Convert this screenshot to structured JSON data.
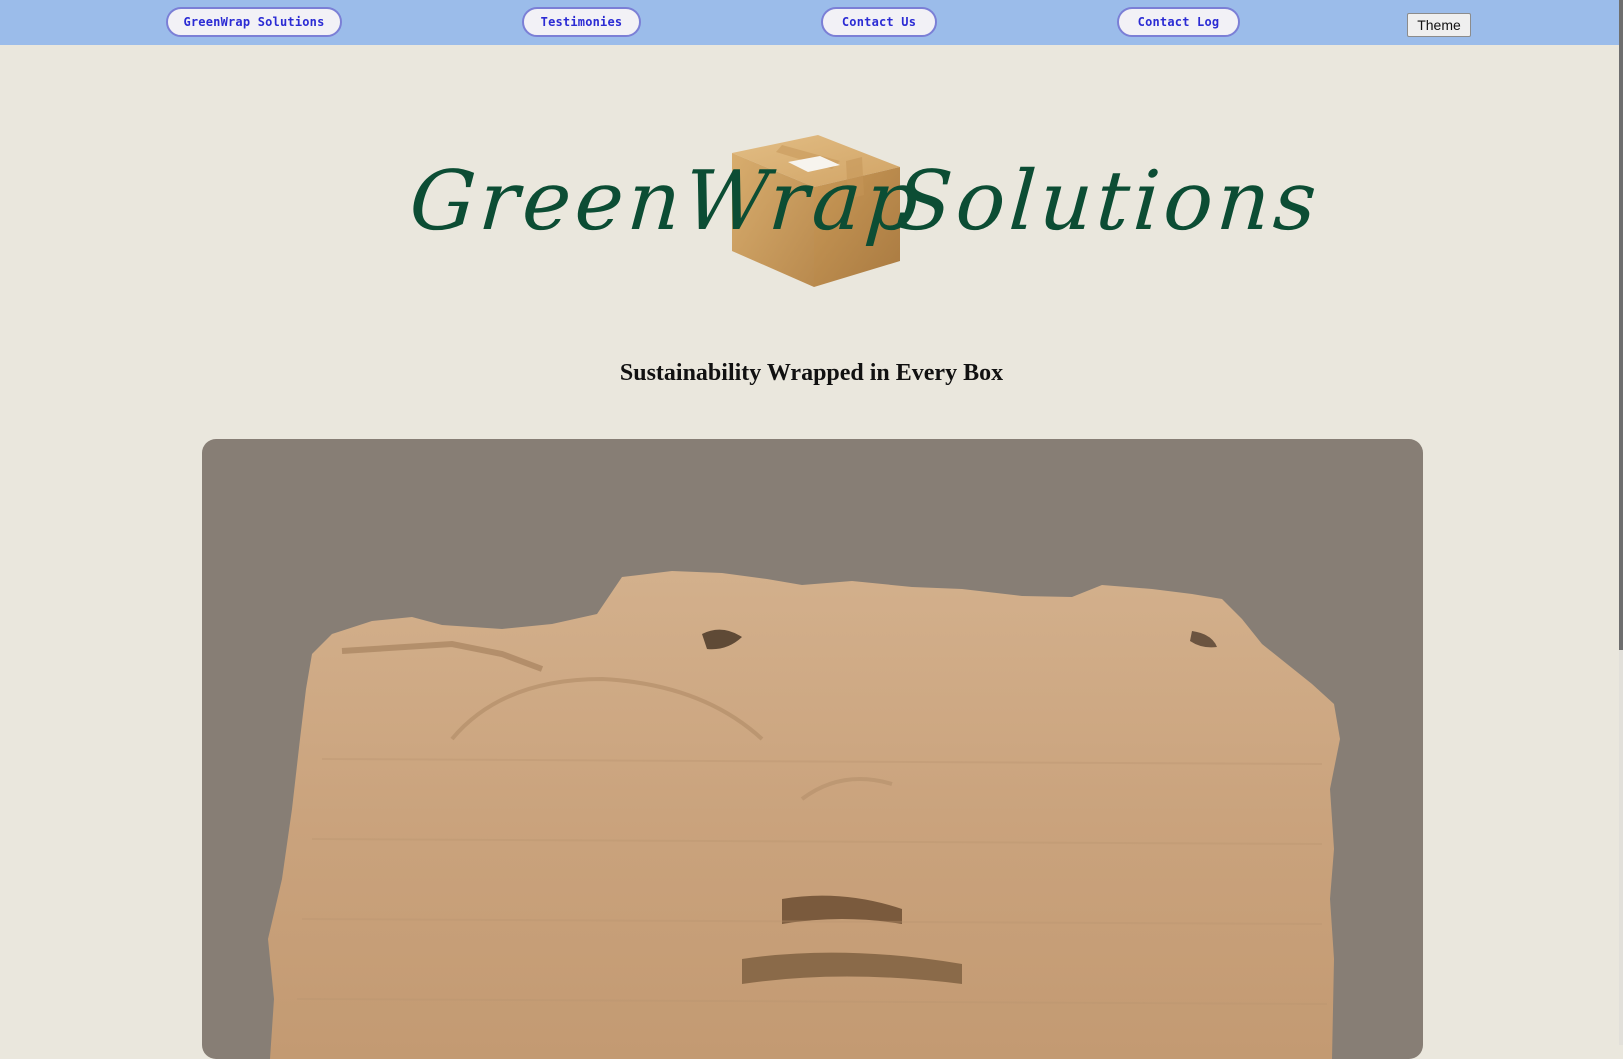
{
  "nav": {
    "items": [
      {
        "label": "GreenWrap Solutions"
      },
      {
        "label": "Testimonies"
      },
      {
        "label": "Contact Us"
      },
      {
        "label": "Contact Log"
      }
    ],
    "theme_label": "Theme"
  },
  "logo": {
    "part1": "GreenWrap",
    "part2": "Solutions"
  },
  "tagline": "Sustainability Wrapped in Every Box",
  "colors": {
    "topbar": "#9bbcea",
    "background": "#eae7dd",
    "logo_green": "#0c4d34",
    "hero_bg": "#877e75",
    "nav_border": "#7b7fd6",
    "nav_text": "#2b2bd4"
  },
  "icons": {
    "logo_box": "cardboard-box-icon",
    "hero": "torn-cardboard-image"
  }
}
